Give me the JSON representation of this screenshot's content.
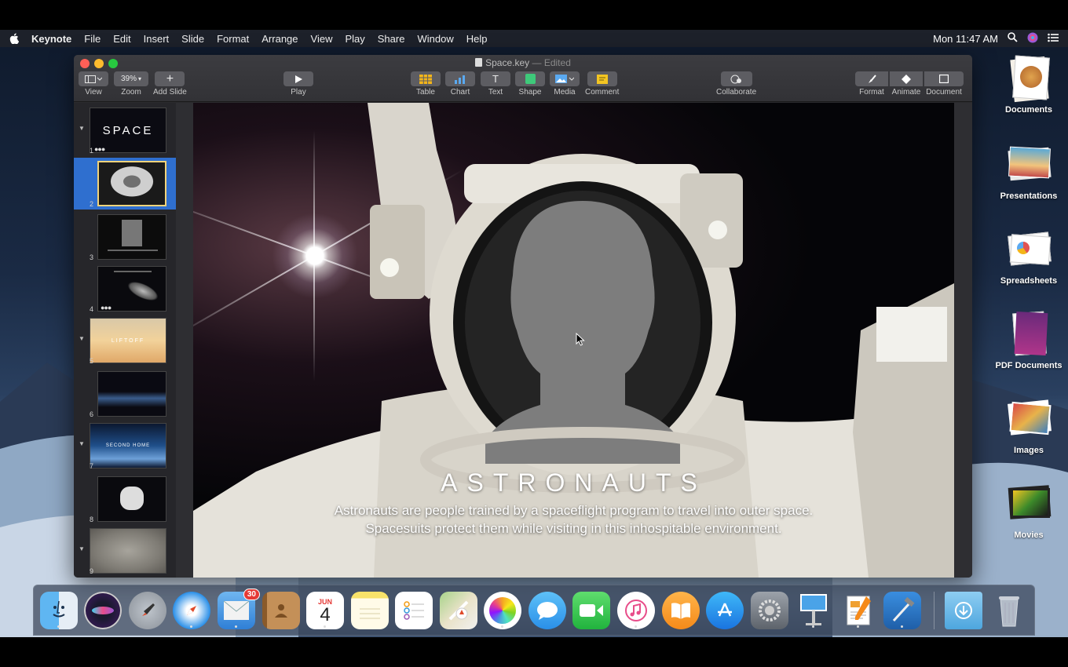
{
  "menubar": {
    "app_name": "Keynote",
    "items": [
      "File",
      "Edit",
      "Insert",
      "Slide",
      "Format",
      "Arrange",
      "View",
      "Play",
      "Share",
      "Window",
      "Help"
    ],
    "clock": "Mon 11:47 AM"
  },
  "window": {
    "title": "Space.key",
    "title_suffix": " — Edited"
  },
  "toolbar": {
    "view_label": "View",
    "zoom_value": "39%",
    "zoom_label": "Zoom",
    "add_slide_label": "Add Slide",
    "play_label": "Play",
    "table_label": "Table",
    "chart_label": "Chart",
    "text_label": "Text",
    "text_icon": "T",
    "shape_label": "Shape",
    "media_label": "Media",
    "comment_label": "Comment",
    "collaborate_label": "Collaborate",
    "format_label": "Format",
    "animate_label": "Animate",
    "document_label": "Document"
  },
  "navigator": {
    "slides": [
      {
        "num": "1",
        "thumb_text": "SPACE",
        "selected": false
      },
      {
        "num": "2",
        "thumb_text": "",
        "selected": true
      },
      {
        "num": "3",
        "thumb_text": "",
        "selected": false
      },
      {
        "num": "4",
        "thumb_text": "",
        "selected": false
      },
      {
        "num": "5",
        "thumb_text": "LIFTOFF",
        "selected": false
      },
      {
        "num": "6",
        "thumb_text": "",
        "selected": false
      },
      {
        "num": "7",
        "thumb_text": "SECOND HOME",
        "selected": false
      },
      {
        "num": "8",
        "thumb_text": "",
        "selected": false
      },
      {
        "num": "9",
        "thumb_text": "",
        "selected": false
      }
    ]
  },
  "slide": {
    "title": "ASTRONAUTS",
    "body_line1": "Astronauts are people trained by a spaceflight program to travel into outer space.",
    "body_line2": "Spacesuits protect them while visiting in this inhospitable environment."
  },
  "desktop": {
    "items": [
      "Documents",
      "Presentations",
      "Spreadsheets",
      "PDF Documents",
      "Images",
      "Movies"
    ]
  },
  "dock": {
    "apps": [
      "Finder",
      "Siri",
      "Launchpad",
      "Safari",
      "Mail",
      "Contacts",
      "Calendar",
      "Notes",
      "Reminders",
      "Maps",
      "Photos",
      "Messages",
      "FaceTime",
      "iTunes",
      "iBooks",
      "App Store",
      "System Preferences",
      "Keynote",
      "Pages",
      "Xcode",
      "Downloads",
      "Trash"
    ],
    "mail_badge": "30",
    "calendar_month": "JUN",
    "calendar_day": "4"
  },
  "colors": {
    "selection_blue": "#2f6fcf",
    "toolbar_button": "#5d5d62",
    "window_bg": "#2b2b2e"
  }
}
